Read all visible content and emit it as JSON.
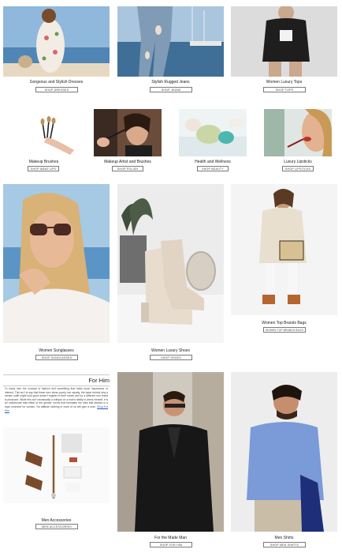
{
  "row1": [
    {
      "caption": "Gorgeous and Stylish Dresses",
      "button": "SHOP DRESSES"
    },
    {
      "caption": "Stylish Rugged Jeans",
      "button": "SHOP JEANS"
    },
    {
      "caption": "Women Luxury Tops",
      "button": "SHOP TOPS"
    }
  ],
  "row2": [
    {
      "caption": "Makeup Brushes",
      "button": "SHOP MAKE UPS"
    },
    {
      "caption": "Makeup Artist and Brushes",
      "button": "SHOP POLISH"
    },
    {
      "caption": "Health and Wellness",
      "button": "SHOP BEAUTY"
    },
    {
      "caption": "Luxury Lipsticks",
      "button": "SHOP LIPSTICKS"
    }
  ],
  "row3": [
    {
      "caption": "Women Sunglasses",
      "button": "SHOP SUNGLASSES"
    },
    {
      "caption": "Women Luxury Shoes",
      "button": "SHOP SHOES"
    },
    {
      "caption": "Women Top Brands Bags",
      "button": "WOMEN TOP BRANDS BAGS"
    }
  ],
  "forhim": {
    "title": "For Him",
    "text": "To many men the concept of fashion isn't something that holds much importance or interest. This isn't to say that these men dress poorly, but usually, the basic behind why a certain outfit might look good doesn't register in their minds and so a different end result is produced. While this isn't necessarily a critique on a man's ability to dress himself, it is an unfortunate side-effect of the gender norms that formulate the idea that fashion is a topic reserved for women, No attitude clothing in most of us will give a man.",
    "link": "Shop For Him"
  },
  "row4": [
    {
      "caption": "Men Accessories",
      "button": "MEN ACCESSORIES"
    },
    {
      "caption": "For the Made Man",
      "button": "SHOP FOR HIM"
    },
    {
      "caption": "Men Shirts",
      "button": "SHOP MEN SHIRTS"
    }
  ],
  "colors": {
    "accent_link": "#2a5db0",
    "button_border": "#7a7a7a",
    "rule": "#c9c9c9"
  }
}
